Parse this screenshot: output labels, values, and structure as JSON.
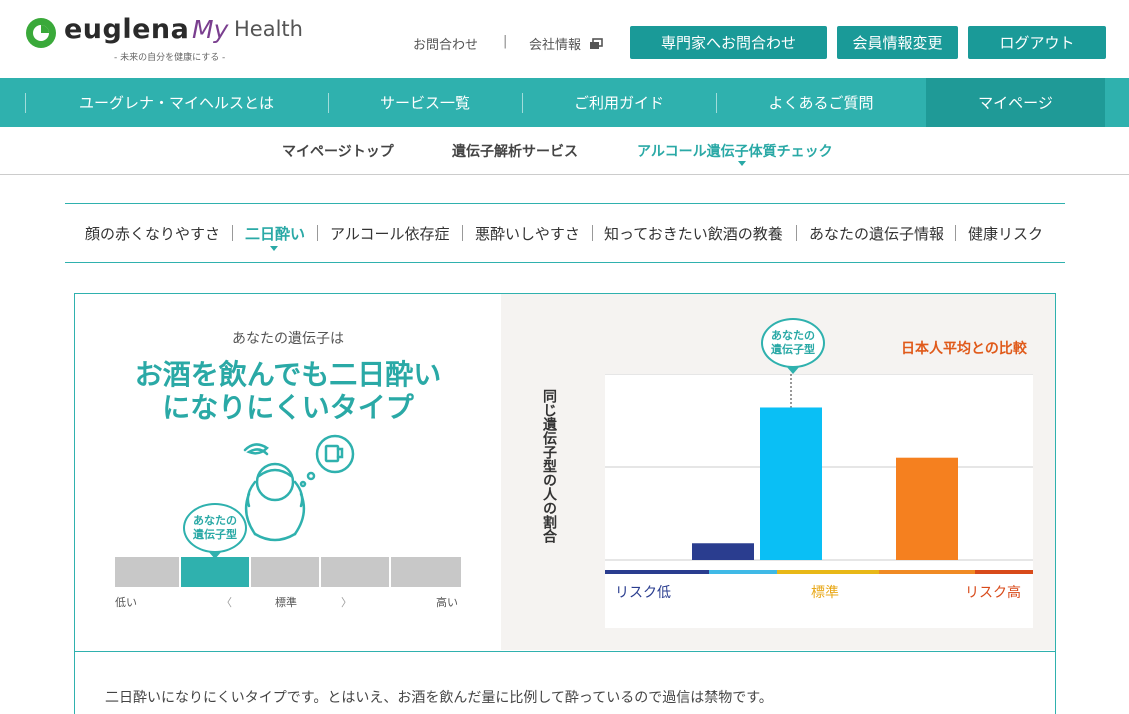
{
  "header": {
    "logo_text": "euglena",
    "logo_my": "My",
    "logo_health": "Health",
    "logo_tagline": "- 未来の自分を健康にする -",
    "links": [
      "お問合わせ",
      "会社情報"
    ],
    "separator": "|",
    "buttons": [
      "専門家へお問合わせ",
      "会員情報変更",
      "ログアウト"
    ]
  },
  "main_nav": {
    "items": [
      "ユーグレナ・マイヘルスとは",
      "サービス一覧",
      "ご利用ガイド",
      "よくあるご質問",
      "マイページ"
    ],
    "active_index": 4
  },
  "sub_nav": {
    "items": [
      "マイページトップ",
      "遺伝子解析サービス",
      "アルコール遺伝子体質チェック"
    ],
    "active_index": 2
  },
  "tabs": {
    "items": [
      "顔の赤くなりやすさ",
      "二日酔い",
      "アルコール依存症",
      "悪酔いしやすさ",
      "知っておきたい飲酒の教養",
      "あなたの遺伝子情報",
      "健康リスク"
    ],
    "active_index": 1
  },
  "result": {
    "label": "あなたの遺伝子は",
    "headline_line1": "お酒を飲んでも二日酔い",
    "headline_line2": "になりにくいタイプ",
    "bubble": "あなたの\n遺伝子型",
    "scale_low": "低い",
    "scale_mid": "標準",
    "scale_high": "高い",
    "scale_prev": "〈",
    "scale_next": "〉",
    "scale_segments": 5,
    "scale_selected_index": 1
  },
  "colors": {
    "teal": "#2fb1ae",
    "teal_dark": "#1a9a98",
    "risk_low": "#2a3d8f",
    "risk_mid": "#e8a818",
    "risk_high": "#d84a1a",
    "bar_you": "#0abff5",
    "bar_avg": "#f5801f"
  },
  "chart_data": {
    "type": "bar",
    "title": "日本人平均との比較",
    "ylabel": "同じ遺伝子型の人の割合",
    "categories": [
      "リスク低",
      "標準",
      "リスク高"
    ],
    "values": [
      9,
      82,
      55
    ],
    "highlight_index": 1,
    "highlight_label": "あなたの\n遺伝子型",
    "ylim": [
      0,
      100
    ],
    "grid": true
  },
  "description": "二日酔いになりにくいタイプです。とはいえ、お酒を飲んだ量に比例して酔っているので過信は禁物です。"
}
